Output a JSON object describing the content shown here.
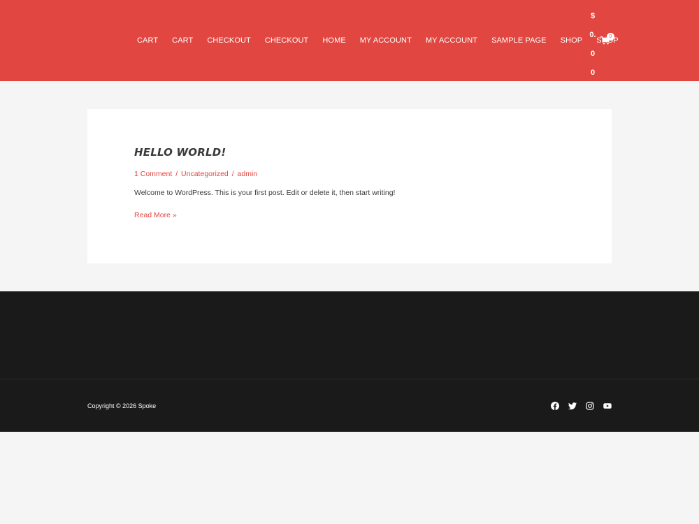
{
  "header": {
    "nav_items": [
      "Cart",
      "Cart",
      "Checkout",
      "Checkout",
      "Home",
      "My Account",
      "My Account",
      "Sample Page",
      "Shop",
      "Shop"
    ],
    "cart_amount_lines": [
      "$",
      "0.",
      "0",
      "0"
    ],
    "cart_count": "0",
    "cart_icon": "shopping-cart-icon"
  },
  "post": {
    "title": "HELLO WORLD!",
    "comments": "1 Comment",
    "category": "Uncategorized",
    "author": "admin",
    "separator": "/",
    "excerpt": "Welcome to WordPress. This is your first post. Edit or delete it, then start writing!",
    "read_more": "Read More »"
  },
  "footer": {
    "copyright": "Copyright © 2026 Spoke",
    "social_icons": [
      "facebook-icon",
      "twitter-icon",
      "instagram-icon",
      "youtube-icon"
    ]
  },
  "colors": {
    "brand": "#e24640",
    "footer_bg": "#1a1a1a",
    "page_bg": "#f5f5f5",
    "text": "#3a3a3a"
  }
}
